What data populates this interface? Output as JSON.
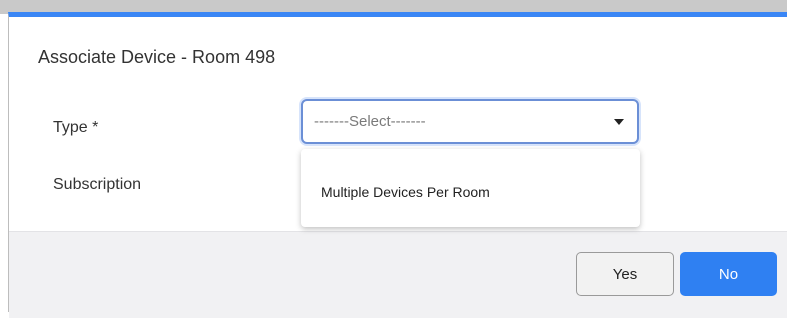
{
  "dialog": {
    "title": "Associate Device - Room 498",
    "accent_color": "#3a86f5"
  },
  "form": {
    "type_label": "Type *",
    "type_select": {
      "selected_text": "-------Select-------",
      "options": [
        "Multiple Devices Per Room"
      ]
    },
    "subscription_label": "Subscription"
  },
  "footer": {
    "yes_label": "Yes",
    "no_label": "No",
    "primary_color": "#2f80f2"
  }
}
